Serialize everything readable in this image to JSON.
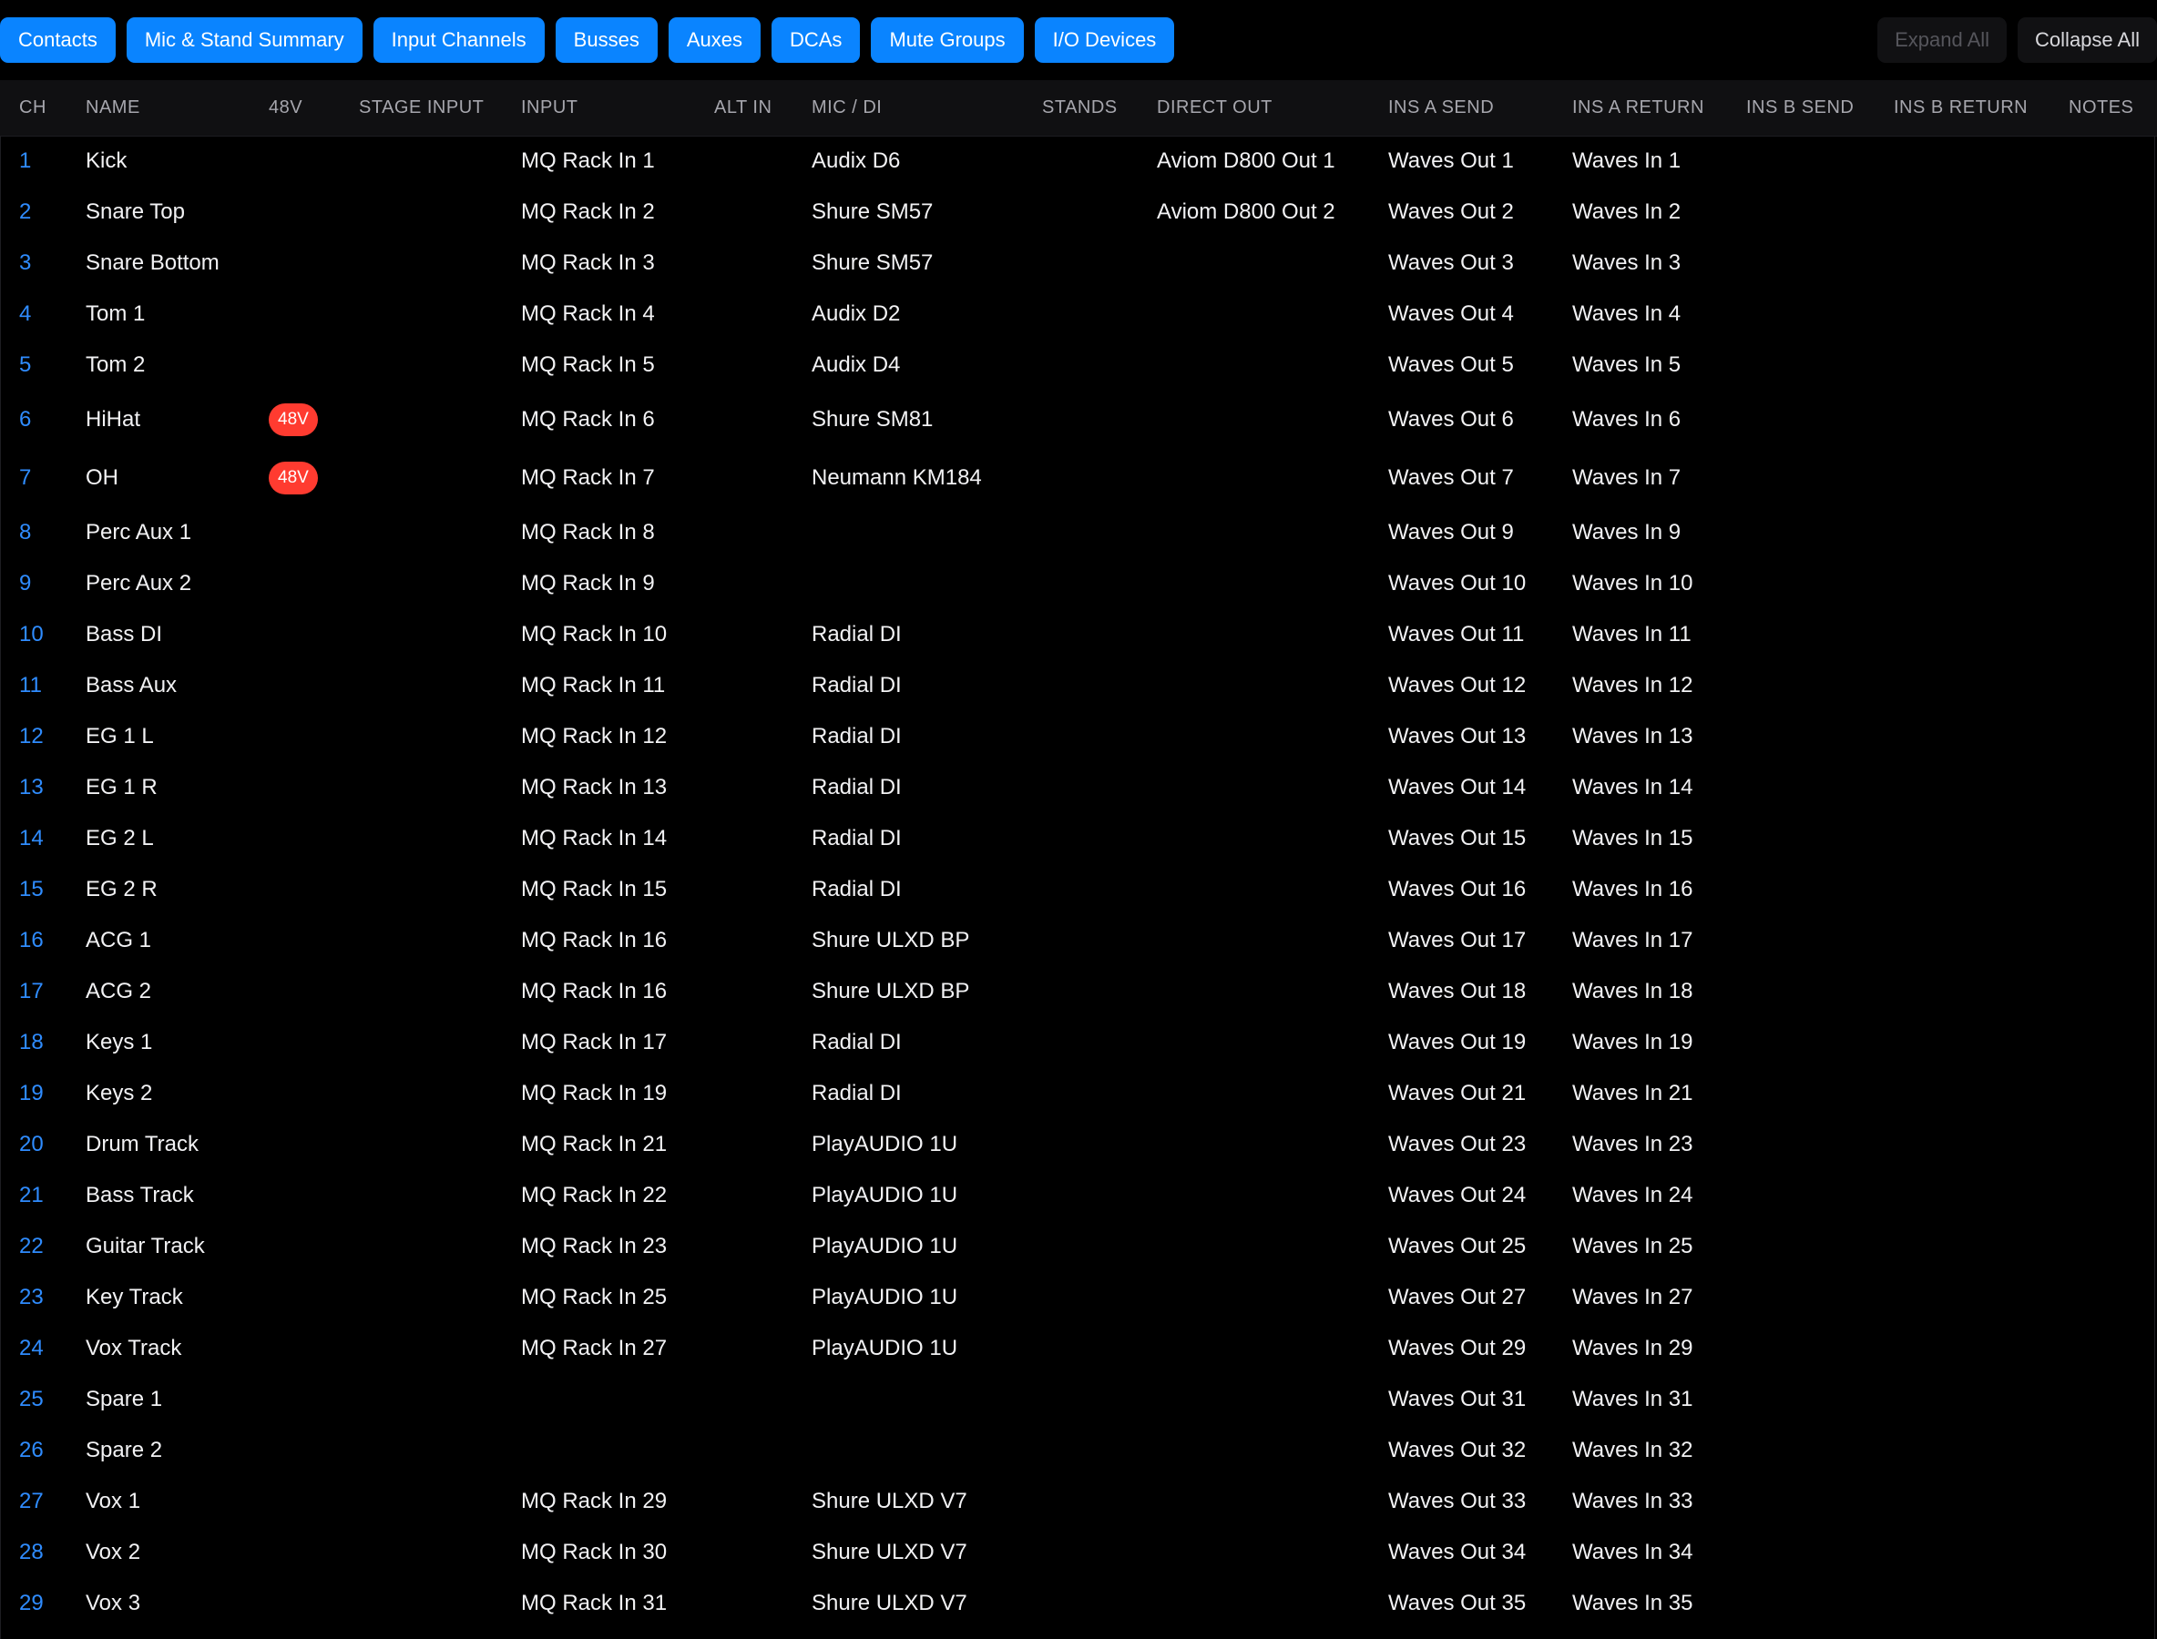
{
  "tabs": [
    "Contacts",
    "Mic & Stand Summary",
    "Input Channels",
    "Busses",
    "Auxes",
    "DCAs",
    "Mute Groups",
    "I/O Devices"
  ],
  "actions": {
    "expand_all": "Expand All",
    "collapse_all": "Collapse All"
  },
  "columns": [
    "CH",
    "NAME",
    "48V",
    "STAGE INPUT",
    "INPUT",
    "ALT IN",
    "MIC / DI",
    "STANDS",
    "DIRECT OUT",
    "INS A SEND",
    "INS A RETURN",
    "INS B SEND",
    "INS B RETURN",
    "NOTES"
  ],
  "colors": {
    "tab_bg": "#0a84ff",
    "channel_number": "#2f8cff",
    "phantom_badge": "#ff3b30",
    "background": "#000000"
  },
  "rows": [
    {
      "ch": "1",
      "name": "Kick",
      "phantom": "",
      "stage_input": "",
      "input": "MQ Rack In 1",
      "alt_in": "",
      "mic_di": "Audix D6",
      "stands": "",
      "direct_out": "Aviom D800 Out 1",
      "ins_a_send": "Waves Out 1",
      "ins_a_return": "Waves In 1",
      "ins_b_send": "",
      "ins_b_return": "",
      "notes": ""
    },
    {
      "ch": "2",
      "name": "Snare Top",
      "phantom": "",
      "stage_input": "",
      "input": "MQ Rack In 2",
      "alt_in": "",
      "mic_di": "Shure SM57",
      "stands": "",
      "direct_out": "Aviom D800 Out 2",
      "ins_a_send": "Waves Out 2",
      "ins_a_return": "Waves In 2",
      "ins_b_send": "",
      "ins_b_return": "",
      "notes": ""
    },
    {
      "ch": "3",
      "name": "Snare Bottom",
      "phantom": "",
      "stage_input": "",
      "input": "MQ Rack In 3",
      "alt_in": "",
      "mic_di": "Shure SM57",
      "stands": "",
      "direct_out": "",
      "ins_a_send": "Waves Out 3",
      "ins_a_return": "Waves In 3",
      "ins_b_send": "",
      "ins_b_return": "",
      "notes": ""
    },
    {
      "ch": "4",
      "name": "Tom 1",
      "phantom": "",
      "stage_input": "",
      "input": "MQ Rack In 4",
      "alt_in": "",
      "mic_di": "Audix D2",
      "stands": "",
      "direct_out": "",
      "ins_a_send": "Waves Out 4",
      "ins_a_return": "Waves In 4",
      "ins_b_send": "",
      "ins_b_return": "",
      "notes": ""
    },
    {
      "ch": "5",
      "name": "Tom 2",
      "phantom": "",
      "stage_input": "",
      "input": "MQ Rack In 5",
      "alt_in": "",
      "mic_di": "Audix D4",
      "stands": "",
      "direct_out": "",
      "ins_a_send": "Waves Out 5",
      "ins_a_return": "Waves In 5",
      "ins_b_send": "",
      "ins_b_return": "",
      "notes": ""
    },
    {
      "ch": "6",
      "name": "HiHat",
      "phantom": "48V",
      "stage_input": "",
      "input": "MQ Rack In 6",
      "alt_in": "",
      "mic_di": "Shure SM81",
      "stands": "",
      "direct_out": "",
      "ins_a_send": "Waves Out 6",
      "ins_a_return": "Waves In 6",
      "ins_b_send": "",
      "ins_b_return": "",
      "notes": ""
    },
    {
      "ch": "7",
      "name": "OH",
      "phantom": "48V",
      "stage_input": "",
      "input": "MQ Rack In 7",
      "alt_in": "",
      "mic_di": "Neumann KM184",
      "stands": "",
      "direct_out": "",
      "ins_a_send": "Waves Out 7",
      "ins_a_return": "Waves In 7",
      "ins_b_send": "",
      "ins_b_return": "",
      "notes": ""
    },
    {
      "ch": "8",
      "name": "Perc Aux 1",
      "phantom": "",
      "stage_input": "",
      "input": "MQ Rack In 8",
      "alt_in": "",
      "mic_di": "",
      "stands": "",
      "direct_out": "",
      "ins_a_send": "Waves Out 9",
      "ins_a_return": "Waves In 9",
      "ins_b_send": "",
      "ins_b_return": "",
      "notes": ""
    },
    {
      "ch": "9",
      "name": "Perc Aux 2",
      "phantom": "",
      "stage_input": "",
      "input": "MQ Rack In 9",
      "alt_in": "",
      "mic_di": "",
      "stands": "",
      "direct_out": "",
      "ins_a_send": "Waves Out 10",
      "ins_a_return": "Waves In 10",
      "ins_b_send": "",
      "ins_b_return": "",
      "notes": ""
    },
    {
      "ch": "10",
      "name": "Bass DI",
      "phantom": "",
      "stage_input": "",
      "input": "MQ Rack In 10",
      "alt_in": "",
      "mic_di": "Radial DI",
      "stands": "",
      "direct_out": "",
      "ins_a_send": "Waves Out 11",
      "ins_a_return": "Waves In 11",
      "ins_b_send": "",
      "ins_b_return": "",
      "notes": ""
    },
    {
      "ch": "11",
      "name": "Bass Aux",
      "phantom": "",
      "stage_input": "",
      "input": "MQ Rack In 11",
      "alt_in": "",
      "mic_di": "Radial DI",
      "stands": "",
      "direct_out": "",
      "ins_a_send": "Waves Out 12",
      "ins_a_return": "Waves In 12",
      "ins_b_send": "",
      "ins_b_return": "",
      "notes": ""
    },
    {
      "ch": "12",
      "name": "EG 1 L",
      "phantom": "",
      "stage_input": "",
      "input": "MQ Rack In 12",
      "alt_in": "",
      "mic_di": "Radial DI",
      "stands": "",
      "direct_out": "",
      "ins_a_send": "Waves Out 13",
      "ins_a_return": "Waves In 13",
      "ins_b_send": "",
      "ins_b_return": "",
      "notes": ""
    },
    {
      "ch": "13",
      "name": "EG 1 R",
      "phantom": "",
      "stage_input": "",
      "input": "MQ Rack In 13",
      "alt_in": "",
      "mic_di": "Radial DI",
      "stands": "",
      "direct_out": "",
      "ins_a_send": "Waves Out 14",
      "ins_a_return": "Waves In 14",
      "ins_b_send": "",
      "ins_b_return": "",
      "notes": ""
    },
    {
      "ch": "14",
      "name": "EG 2 L",
      "phantom": "",
      "stage_input": "",
      "input": "MQ Rack In 14",
      "alt_in": "",
      "mic_di": "Radial DI",
      "stands": "",
      "direct_out": "",
      "ins_a_send": "Waves Out 15",
      "ins_a_return": "Waves In 15",
      "ins_b_send": "",
      "ins_b_return": "",
      "notes": ""
    },
    {
      "ch": "15",
      "name": "EG 2 R",
      "phantom": "",
      "stage_input": "",
      "input": "MQ Rack In 15",
      "alt_in": "",
      "mic_di": "Radial DI",
      "stands": "",
      "direct_out": "",
      "ins_a_send": "Waves Out 16",
      "ins_a_return": "Waves In 16",
      "ins_b_send": "",
      "ins_b_return": "",
      "notes": ""
    },
    {
      "ch": "16",
      "name": "ACG 1",
      "phantom": "",
      "stage_input": "",
      "input": "MQ Rack In 16",
      "alt_in": "",
      "mic_di": "Shure ULXD BP",
      "stands": "",
      "direct_out": "",
      "ins_a_send": "Waves Out 17",
      "ins_a_return": "Waves In 17",
      "ins_b_send": "",
      "ins_b_return": "",
      "notes": ""
    },
    {
      "ch": "17",
      "name": "ACG 2",
      "phantom": "",
      "stage_input": "",
      "input": "MQ Rack In 16",
      "alt_in": "",
      "mic_di": "Shure ULXD BP",
      "stands": "",
      "direct_out": "",
      "ins_a_send": "Waves Out 18",
      "ins_a_return": "Waves In 18",
      "ins_b_send": "",
      "ins_b_return": "",
      "notes": ""
    },
    {
      "ch": "18",
      "name": "Keys 1",
      "phantom": "",
      "stage_input": "",
      "input": "MQ Rack In 17",
      "alt_in": "",
      "mic_di": "Radial DI",
      "stands": "",
      "direct_out": "",
      "ins_a_send": "Waves Out 19",
      "ins_a_return": "Waves In 19",
      "ins_b_send": "",
      "ins_b_return": "",
      "notes": ""
    },
    {
      "ch": "19",
      "name": "Keys 2",
      "phantom": "",
      "stage_input": "",
      "input": "MQ Rack In 19",
      "alt_in": "",
      "mic_di": "Radial DI",
      "stands": "",
      "direct_out": "",
      "ins_a_send": "Waves Out 21",
      "ins_a_return": "Waves In 21",
      "ins_b_send": "",
      "ins_b_return": "",
      "notes": ""
    },
    {
      "ch": "20",
      "name": "Drum Track",
      "phantom": "",
      "stage_input": "",
      "input": "MQ Rack In 21",
      "alt_in": "",
      "mic_di": "PlayAUDIO 1U",
      "stands": "",
      "direct_out": "",
      "ins_a_send": "Waves Out 23",
      "ins_a_return": "Waves In 23",
      "ins_b_send": "",
      "ins_b_return": "",
      "notes": ""
    },
    {
      "ch": "21",
      "name": "Bass Track",
      "phantom": "",
      "stage_input": "",
      "input": "MQ Rack In 22",
      "alt_in": "",
      "mic_di": "PlayAUDIO 1U",
      "stands": "",
      "direct_out": "",
      "ins_a_send": "Waves Out 24",
      "ins_a_return": "Waves In 24",
      "ins_b_send": "",
      "ins_b_return": "",
      "notes": ""
    },
    {
      "ch": "22",
      "name": "Guitar Track",
      "phantom": "",
      "stage_input": "",
      "input": "MQ Rack In 23",
      "alt_in": "",
      "mic_di": "PlayAUDIO 1U",
      "stands": "",
      "direct_out": "",
      "ins_a_send": "Waves Out 25",
      "ins_a_return": "Waves In 25",
      "ins_b_send": "",
      "ins_b_return": "",
      "notes": ""
    },
    {
      "ch": "23",
      "name": "Key Track",
      "phantom": "",
      "stage_input": "",
      "input": "MQ Rack In 25",
      "alt_in": "",
      "mic_di": "PlayAUDIO 1U",
      "stands": "",
      "direct_out": "",
      "ins_a_send": "Waves Out 27",
      "ins_a_return": "Waves In 27",
      "ins_b_send": "",
      "ins_b_return": "",
      "notes": ""
    },
    {
      "ch": "24",
      "name": "Vox Track",
      "phantom": "",
      "stage_input": "",
      "input": "MQ Rack In 27",
      "alt_in": "",
      "mic_di": "PlayAUDIO 1U",
      "stands": "",
      "direct_out": "",
      "ins_a_send": "Waves Out 29",
      "ins_a_return": "Waves In 29",
      "ins_b_send": "",
      "ins_b_return": "",
      "notes": ""
    },
    {
      "ch": "25",
      "name": "Spare 1",
      "phantom": "",
      "stage_input": "",
      "input": "",
      "alt_in": "",
      "mic_di": "",
      "stands": "",
      "direct_out": "",
      "ins_a_send": "Waves Out 31",
      "ins_a_return": "Waves In 31",
      "ins_b_send": "",
      "ins_b_return": "",
      "notes": ""
    },
    {
      "ch": "26",
      "name": "Spare 2",
      "phantom": "",
      "stage_input": "",
      "input": "",
      "alt_in": "",
      "mic_di": "",
      "stands": "",
      "direct_out": "",
      "ins_a_send": "Waves Out 32",
      "ins_a_return": "Waves In 32",
      "ins_b_send": "",
      "ins_b_return": "",
      "notes": ""
    },
    {
      "ch": "27",
      "name": "Vox 1",
      "phantom": "",
      "stage_input": "",
      "input": "MQ Rack In 29",
      "alt_in": "",
      "mic_di": "Shure ULXD V7",
      "stands": "",
      "direct_out": "",
      "ins_a_send": "Waves Out 33",
      "ins_a_return": "Waves In 33",
      "ins_b_send": "",
      "ins_b_return": "",
      "notes": ""
    },
    {
      "ch": "28",
      "name": "Vox 2",
      "phantom": "",
      "stage_input": "",
      "input": "MQ Rack In 30",
      "alt_in": "",
      "mic_di": "Shure ULXD V7",
      "stands": "",
      "direct_out": "",
      "ins_a_send": "Waves Out 34",
      "ins_a_return": "Waves In 34",
      "ins_b_send": "",
      "ins_b_return": "",
      "notes": ""
    },
    {
      "ch": "29",
      "name": "Vox 3",
      "phantom": "",
      "stage_input": "",
      "input": "MQ Rack In 31",
      "alt_in": "",
      "mic_di": "Shure ULXD V7",
      "stands": "",
      "direct_out": "",
      "ins_a_send": "Waves Out 35",
      "ins_a_return": "Waves In 35",
      "ins_b_send": "",
      "ins_b_return": "",
      "notes": ""
    }
  ]
}
